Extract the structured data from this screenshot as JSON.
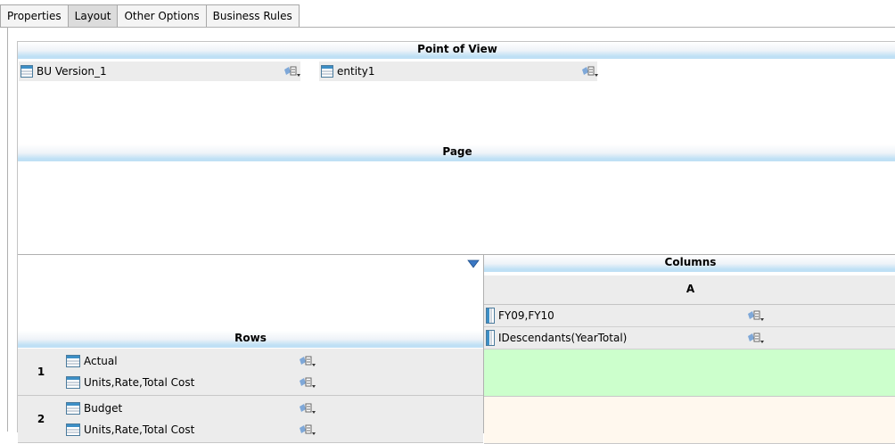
{
  "tabs": [
    {
      "label": "Properties",
      "active": false
    },
    {
      "label": "Layout",
      "active": true
    },
    {
      "label": "Other Options",
      "active": false
    },
    {
      "label": "Business Rules",
      "active": false
    }
  ],
  "pov": {
    "title": "Point of View",
    "items": [
      {
        "label": "BU Version_1",
        "icon": "dimension-icon",
        "selector": "member-selector-icon"
      },
      {
        "label": "entity1",
        "icon": "dimension-icon",
        "selector": "member-selector-icon"
      }
    ]
  },
  "page": {
    "title": "Page"
  },
  "rows": {
    "title": "Rows",
    "items": [
      {
        "number": "1",
        "members": [
          {
            "label": "Actual",
            "icon": "dimension-icon",
            "selector": "member-selector-icon"
          },
          {
            "label": "Units,Rate,Total Cost",
            "icon": "dimension-icon",
            "selector": "member-selector-icon"
          }
        ]
      },
      {
        "number": "2",
        "members": [
          {
            "label": "Budget",
            "icon": "dimension-icon",
            "selector": "member-selector-icon"
          },
          {
            "label": "Units,Rate,Total Cost",
            "icon": "dimension-icon",
            "selector": "member-selector-icon"
          }
        ]
      }
    ]
  },
  "columns": {
    "title": "Columns",
    "segment": "A",
    "members": [
      {
        "label": "FY09,FY10",
        "icon": "column-dimension-icon",
        "selector": "member-selector-icon"
      },
      {
        "label": "IDescendants(YearTotal)",
        "icon": "column-dimension-icon",
        "selector": "member-selector-icon"
      }
    ]
  },
  "colors": {
    "band_blue": "#bfe0f5",
    "cell_gray": "#ececec",
    "row1_data": "#ccffcc",
    "row2_data": "#fff8ee",
    "chevron_blue": "#3a78c4"
  }
}
